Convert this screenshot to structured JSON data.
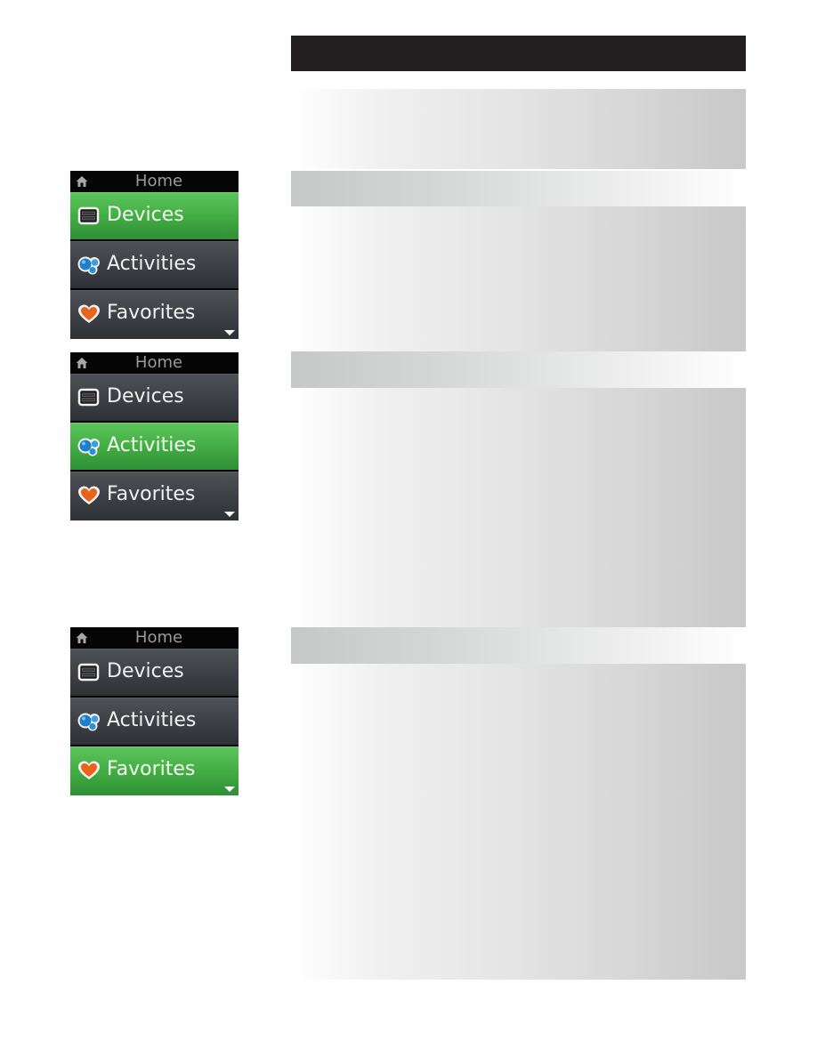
{
  "document": {
    "header_bar": {
      "text": ""
    },
    "sections": [
      {
        "title": ""
      },
      {
        "title": ""
      },
      {
        "title": ""
      }
    ]
  },
  "remote_screens": [
    {
      "title": "Home",
      "selected_index": 0,
      "items": [
        {
          "label": "Devices",
          "icon": "devices-icon"
        },
        {
          "label": "Activities",
          "icon": "activities-icon"
        },
        {
          "label": "Favorites",
          "icon": "favorites-heart-icon"
        }
      ],
      "more_below": true
    },
    {
      "title": "Home",
      "selected_index": 1,
      "items": [
        {
          "label": "Devices",
          "icon": "devices-icon"
        },
        {
          "label": "Activities",
          "icon": "activities-icon"
        },
        {
          "label": "Favorites",
          "icon": "favorites-heart-icon"
        }
      ],
      "more_below": true
    },
    {
      "title": "Home",
      "selected_index": 2,
      "items": [
        {
          "label": "Devices",
          "icon": "devices-icon"
        },
        {
          "label": "Activities",
          "icon": "activities-icon"
        },
        {
          "label": "Favorites",
          "icon": "favorites-heart-icon"
        }
      ],
      "more_below": true
    }
  ],
  "colors": {
    "header_bar": "#231f20",
    "selected_item": "#45b046",
    "unselected_item": "#3d4145",
    "heart": "#e8641c",
    "activities_bubble": "#1e7fc8"
  }
}
